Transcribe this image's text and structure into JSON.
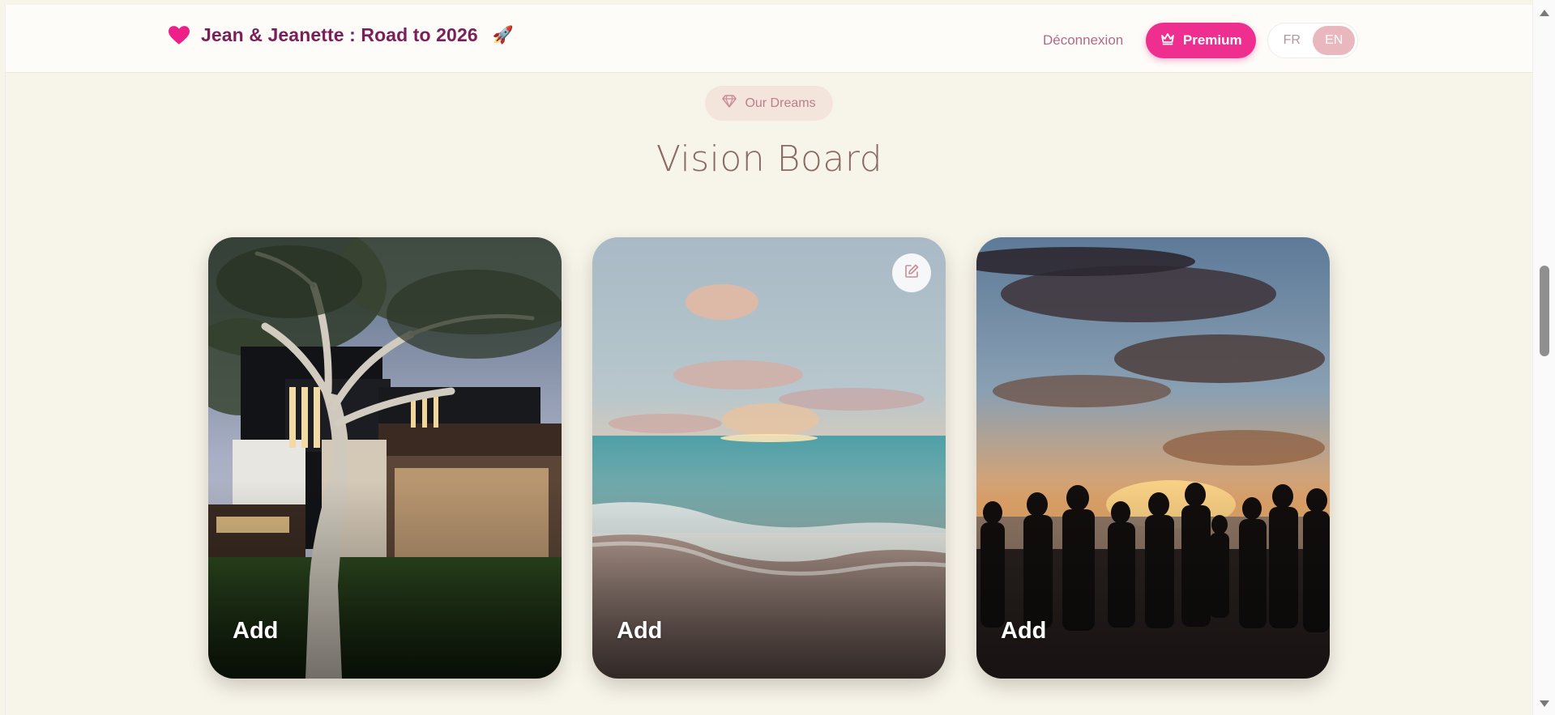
{
  "header": {
    "brand_icon": "heart-icon",
    "title": "Jean & Jeanette : Road to 2026",
    "title_emoji": "🚀",
    "logout_label": "Déconnexion",
    "premium_label": "Premium",
    "premium_icon": "crown-icon",
    "languages": [
      "FR",
      "EN"
    ],
    "active_language": "EN"
  },
  "section": {
    "badge_icon": "diamond-icon",
    "badge_label": "Our Dreams",
    "title": "Vision Board"
  },
  "cards": [
    {
      "label": "Add",
      "scene": "modern-house-with-tree"
    },
    {
      "label": "Add",
      "scene": "beach-sunset",
      "edit_icon": "edit-icon"
    },
    {
      "label": "Add",
      "scene": "family-silhouette-sunset"
    }
  ],
  "colors": {
    "accent": "#ef2f8f",
    "brand_text": "#7a1f5a",
    "background": "#f7f5ea",
    "title_text": "#8a6a62"
  }
}
